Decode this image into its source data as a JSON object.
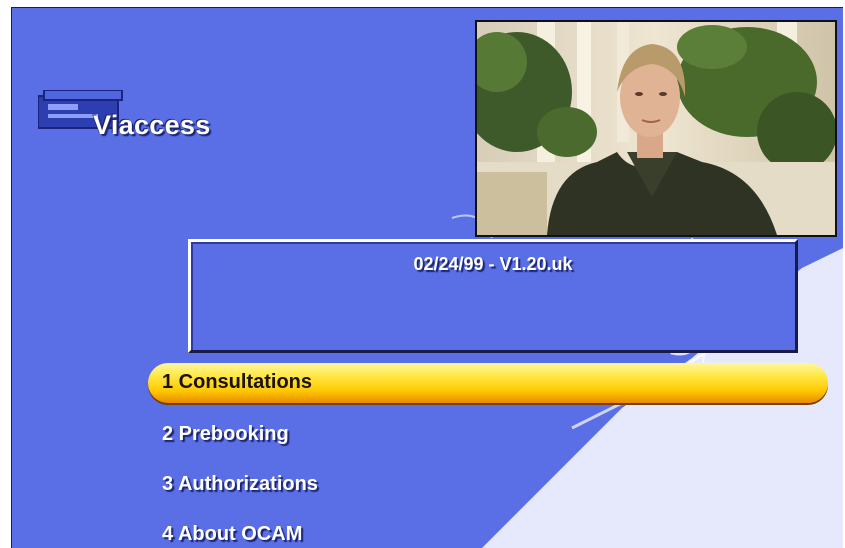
{
  "app": {
    "logo_text": "Viaccess"
  },
  "info": {
    "version_text": "02/24/99 - V1.20.uk"
  },
  "menu": {
    "items": [
      {
        "label": "1 Consultations",
        "selected": true
      },
      {
        "label": "2 Prebooking",
        "selected": false
      },
      {
        "label": "3 Authorizations",
        "selected": false
      },
      {
        "label": "4 About OCAM",
        "selected": false
      }
    ]
  },
  "colors": {
    "background": "#5a6fe6",
    "highlight": "#ffd21a",
    "text": "#ffffff"
  },
  "icons": {
    "logo": "viaccess-card-icon"
  }
}
